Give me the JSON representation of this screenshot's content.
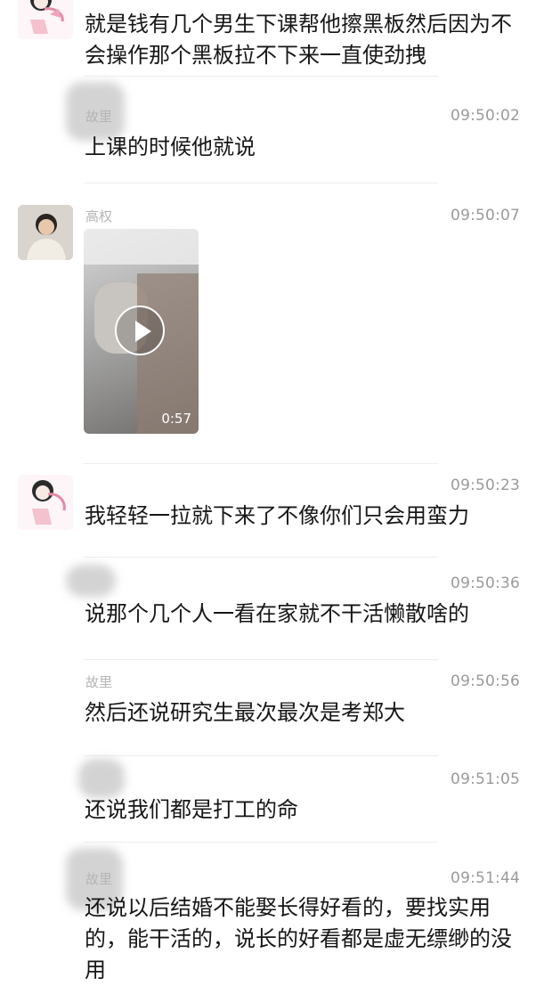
{
  "messages": [
    {
      "id": "m1",
      "sender": "",
      "time": "",
      "text": "就是钱有几个男生下课帮他擦黑板然后因为不会操作那个黑板拉不下来一直使劲拽"
    },
    {
      "id": "m2",
      "sender": "故里",
      "time": "09:50:02",
      "text": "上课的时候他就说"
    },
    {
      "id": "m3",
      "sender": "高权",
      "time": "09:50:07",
      "video": {
        "duration": "0:57"
      }
    },
    {
      "id": "m4",
      "sender": "",
      "time": "09:50:23",
      "text": "我轻轻一拉就下来了不像你们只会用蛮力"
    },
    {
      "id": "m5",
      "sender": "",
      "time": "09:50:36",
      "text": "说那个几个人一看在家就不干活懒散啥的"
    },
    {
      "id": "m6",
      "sender": "故里",
      "time": "09:50:56",
      "text": "然后还说研究生最次最次是考郑大"
    },
    {
      "id": "m7",
      "sender": "",
      "time": "09:51:05",
      "text": "还说我们都是打工的命"
    },
    {
      "id": "m8",
      "sender": "故里",
      "time": "09:51:44",
      "text": "还说以后结婚不能娶长得好看的，要找实用的，能干活的，说长的好看都是虚无缥缈的没用"
    }
  ],
  "colors": {
    "background": "#ffffff",
    "timestamp": "#9a9a9a",
    "text": "#161616"
  },
  "icons": {
    "play": "play-icon"
  }
}
